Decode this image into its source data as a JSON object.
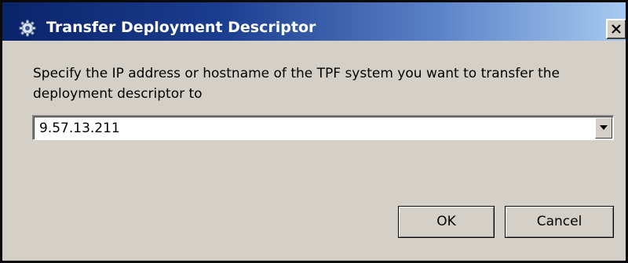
{
  "dialog": {
    "title": "Transfer Deployment Descriptor",
    "icon": "gear-icon",
    "close_label": "close-icon"
  },
  "prompt": {
    "text": "Specify the IP address or hostname of the TPF system you want to transfer the deployment descriptor to"
  },
  "host_combo": {
    "value": "9.57.13.211"
  },
  "buttons": {
    "ok_label": "OK",
    "cancel_label": "Cancel"
  },
  "colors": {
    "titlebar_start": "#0a246a",
    "titlebar_end": "#a6caf0",
    "dialog_bg": "#d4d0c8"
  }
}
